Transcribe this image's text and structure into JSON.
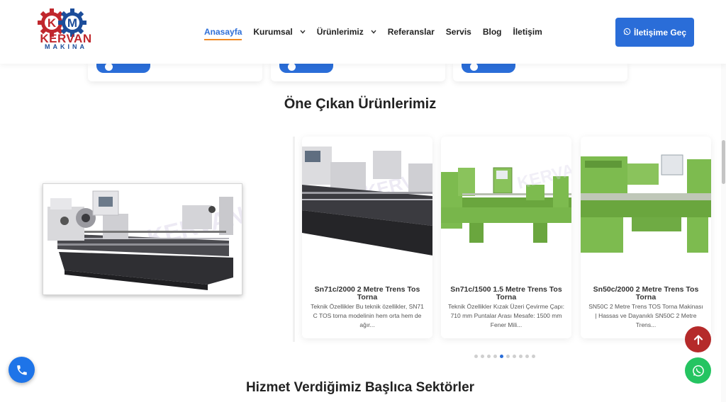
{
  "header": {
    "logo_text": "KERVAN",
    "logo_sub": "MAKINA",
    "nav": [
      {
        "label": "Anasayfa",
        "active": true,
        "dropdown": false
      },
      {
        "label": "Kurumsal",
        "active": false,
        "dropdown": true
      },
      {
        "label": "Ürünlerimiz",
        "active": false,
        "dropdown": true
      },
      {
        "label": "Referanslar",
        "active": false,
        "dropdown": false
      },
      {
        "label": "Servis",
        "active": false,
        "dropdown": false
      },
      {
        "label": "Blog",
        "active": false,
        "dropdown": false
      },
      {
        "label": "İletişim",
        "active": false,
        "dropdown": false
      }
    ],
    "cta_label": "İletişime Geç",
    "cta_icon": "whatsapp-icon"
  },
  "featured": {
    "title": "Öne Çıkan Ürünlerimiz",
    "products": [
      {
        "title": "Sn71c/2000 2 Metre Trens Tos Torna",
        "desc": "Teknik Özellikler Bu teknik özellikler, SN71 C TOS torna modelinin hem orta hem de ağır..."
      },
      {
        "title": "Sn71c/1500 1.5 Metre Trens Tos Torna",
        "desc": "Teknik Özellikler Kızak Üzeri Çevirme Çapı: 710 mm Puntalar Arası Mesafe: 1500 mm Fener Mili..."
      },
      {
        "title": "Sn50c/2000 2 Metre Trens Tos Torna",
        "desc": "SN50C 2 Metre Trens TOS Torna Makinası | Hassas ve Dayanıklı SN50C 2 Metre Trens..."
      }
    ],
    "pagination": {
      "total": 10,
      "active_index": 4
    }
  },
  "sectors": {
    "title": "Hizmet Verdiğimiz Başlıca Sektörler"
  },
  "colors": {
    "accent": "#2a6dd8",
    "brand_red": "#c0272d",
    "brand_blue": "#1c4d9a",
    "nav_underline": "#f08a24",
    "scroll_top": "#b52a2a",
    "whatsapp": "#25c461",
    "machine_green": "#7dbb4f"
  }
}
